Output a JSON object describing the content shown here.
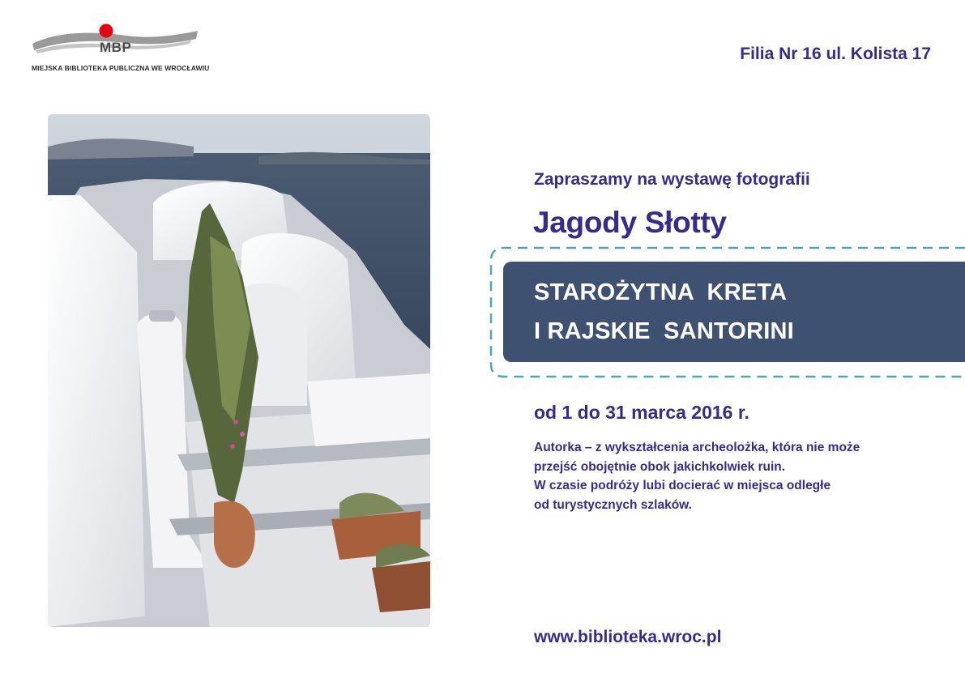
{
  "logo": {
    "abbr": "MBP",
    "full_name": "MIEJSKA BIBLIOTEKA PUBLICZNA WE WROCŁAWIU",
    "colors": {
      "swoosh": "#9a9a9a",
      "dot": "#e30613"
    }
  },
  "branch": "Filia Nr 16 ul. Kolista 17",
  "invite": "Zapraszamy na wystawę fotografii",
  "author": "Jagody Słotty",
  "exhibition_title": {
    "line1": "STAROŻYTNA  KRETA",
    "line2": "I RAJSKIE  SANTORINI"
  },
  "dates": "od 1 do 31 marca 2016 r.",
  "description": [
    "Autorka – z wykształcenia archeolożka, która nie może",
    "przejść obojętnie obok jakichkolwiek ruin.",
    "W czasie podróży lubi docierać w miejsca odległe",
    "od turystycznych szlaków."
  ],
  "website": "www.biblioteka.wroc.pl",
  "colors": {
    "text": "#3a2a8c",
    "title_box": "#3e5170",
    "dashed_frame": "#4fa8b0"
  },
  "photo": {
    "subject": "photo of white Santorini houses above the sea"
  }
}
